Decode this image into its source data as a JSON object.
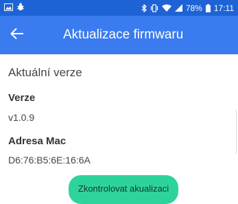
{
  "status_bar": {
    "left_icons": [
      "image-icon",
      "bug-icon"
    ],
    "right_icons": [
      "bluetooth-icon",
      "vibrate-icon",
      "wifi-icon",
      "signal-icon",
      "battery-icon"
    ],
    "battery": "78%",
    "time": "17:11"
  },
  "app_bar": {
    "back_icon": "arrow-left-icon",
    "title": "Aktualizace firmwaru"
  },
  "main": {
    "section_title": "Aktuální verze",
    "version_label": "Verze",
    "version_value": "v1.0.9",
    "mac_label": "Adresa Mac",
    "mac_value": "D6:76:B5:6E:16:6A",
    "check_button": "Zkontrolovat akualizaci"
  },
  "colors": {
    "status_bar": "#1e63d6",
    "app_bar": "#3a7bef",
    "button": "#2ed39b"
  }
}
